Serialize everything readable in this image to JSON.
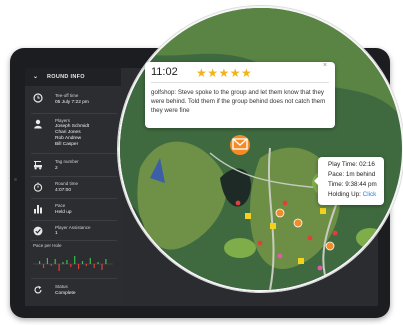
{
  "sidebar": {
    "header": "ROUND INFO",
    "tee_off": {
      "label": "Tee-off time",
      "value": "05 July 7:22 pm"
    },
    "players": {
      "label": "Players",
      "names": [
        "Joseph Schmidt",
        "Chari Jones",
        "Rob Andrew",
        "Bill Casper"
      ]
    },
    "tag": {
      "label": "Tag number",
      "value": "2"
    },
    "round_time": {
      "label": "Round time",
      "value": "4:07:00"
    },
    "pace": {
      "label": "Pace",
      "value": "Held up"
    },
    "assistance": {
      "label": "Player Assistance",
      "value": "1"
    },
    "pace_per_hole": {
      "label": "Pace per Hole"
    },
    "status": {
      "label": "Status",
      "value": "Complete"
    }
  },
  "note": {
    "time": "11:02",
    "stars": "★★★★★",
    "rating": 5,
    "close": "×",
    "message": "golfshop: Steve spoke to the group and let them know that they were behind. Told them if the group behind does not catch them they were fine"
  },
  "pace_popup": {
    "play_time": "Play Time: 02:16",
    "pace": "Pace: 1m behind",
    "time": "Time: 9:38:44 pm",
    "holding_up_label": "Holding Up: ",
    "holding_up_link": "Click"
  },
  "colors": {
    "tablet": "#1b1d21",
    "sidebar": "#2b2d31",
    "accent_orange": "#f28c28",
    "star": "#f2b31c",
    "link": "#2a7fd4",
    "pace_ahead": "#3fbf4a",
    "pace_behind": "#e0403a"
  }
}
